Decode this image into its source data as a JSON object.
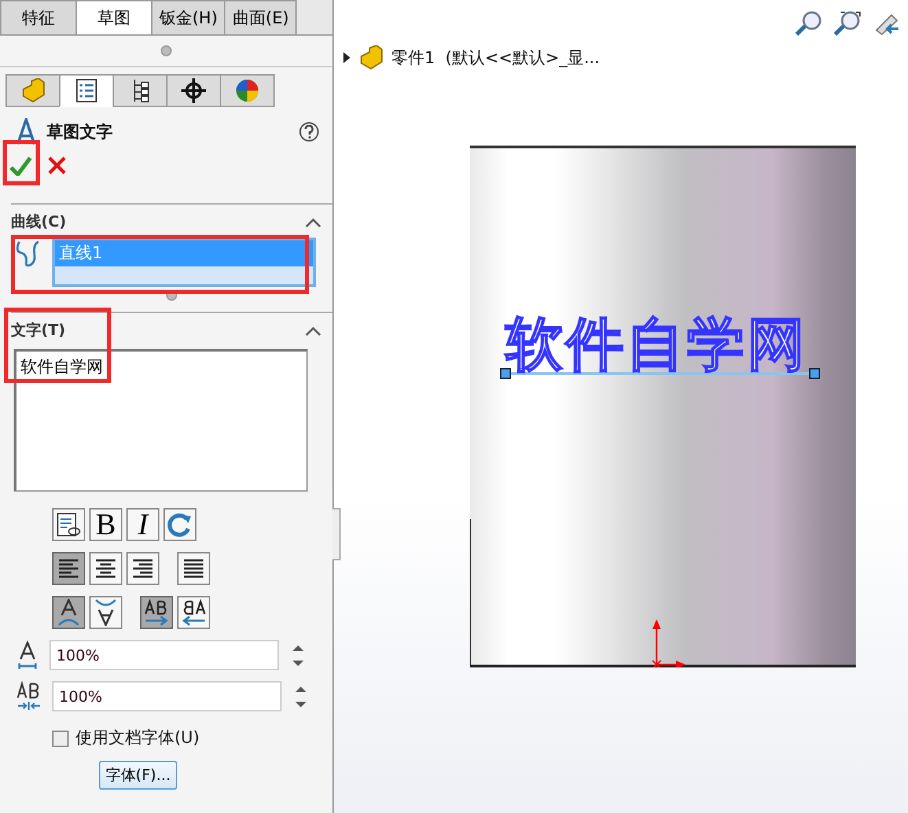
{
  "feature_tabs": [
    {
      "label": "特征",
      "selected": false
    },
    {
      "label": "草图",
      "selected": true
    },
    {
      "label": "钣金(H)",
      "selected": false
    },
    {
      "label": "曲面(E)",
      "selected": false
    }
  ],
  "panel_tabs": [
    {
      "kind": "part",
      "selected": false
    },
    {
      "kind": "list",
      "selected": true
    },
    {
      "kind": "tree",
      "selected": false
    },
    {
      "kind": "target",
      "selected": false
    },
    {
      "kind": "appearance",
      "selected": false
    }
  ],
  "property_manager": {
    "title": "草图文字"
  },
  "curve_section": {
    "title": "曲线(C)",
    "items": [
      {
        "label": "直线1",
        "selected": true
      }
    ]
  },
  "text_section": {
    "title": "文字(T)",
    "value": "软件自学网"
  },
  "format_buttons": [
    [
      {
        "kind": "link",
        "on": false
      },
      {
        "kind": "bold",
        "label": "B",
        "on": false
      },
      {
        "kind": "italic",
        "label": "I",
        "on": false
      },
      {
        "kind": "rotate",
        "on": false
      }
    ],
    [
      {
        "kind": "align-left",
        "on": true
      },
      {
        "kind": "align-center",
        "on": false
      },
      {
        "kind": "align-right",
        "on": false
      },
      {
        "kind": "justify",
        "on": false
      }
    ],
    [
      {
        "kind": "arc-up",
        "on": true
      },
      {
        "kind": "arc-flip",
        "on": false
      },
      {
        "kind": "forward",
        "on": true
      },
      {
        "kind": "reverse",
        "on": false
      }
    ]
  ],
  "fields": [
    {
      "kind": "width",
      "value": "100%"
    },
    {
      "kind": "spacing",
      "value": "100%"
    }
  ],
  "doc_font_checkbox": {
    "label": "使用文档字体(U)",
    "checked": false
  },
  "font_button": {
    "label": "字体(F)..."
  },
  "tree": {
    "label": "零件1  (默认<<默认>_显...",
    "expanded": false
  },
  "model": {
    "sketch_text": "软件自学网"
  }
}
